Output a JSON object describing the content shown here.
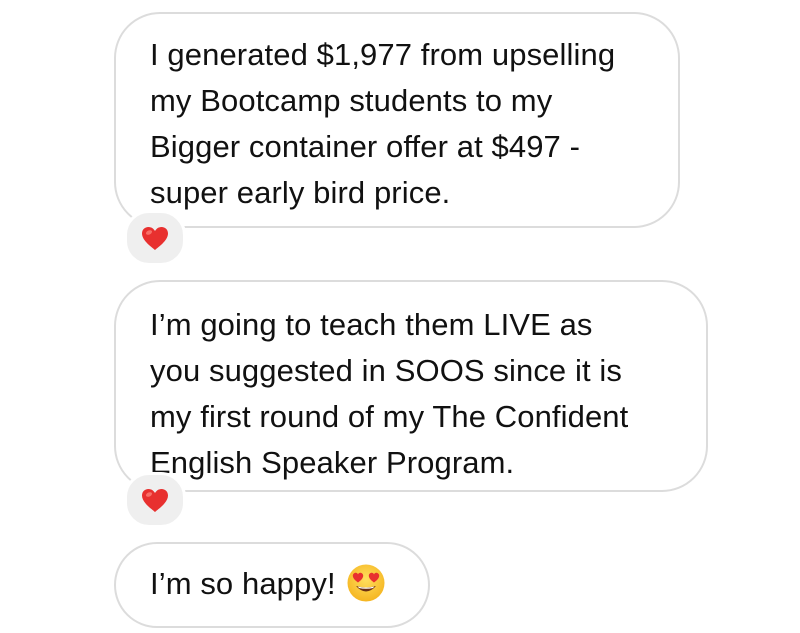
{
  "messages": [
    {
      "lines": [
        "I generated $1,977 from upselling",
        "my Bootcamp students to my",
        "Bigger container offer at $497 -",
        "super early bird price."
      ],
      "reaction": "heart-icon"
    },
    {
      "lines": [
        "I’m going to teach them LIVE as",
        "you suggested in SOOS since it is",
        "my first round of my The Confident",
        "English Speaker Program."
      ],
      "reaction": "heart-icon"
    },
    {
      "lines": [
        "I’m so happy!"
      ],
      "emoji": "smiling-face-with-heart-eyes-icon"
    }
  ],
  "colors": {
    "bubble_border": "#dcdcdc",
    "reaction_background": "#efefef",
    "heart": "#e8302f",
    "text": "#111111"
  }
}
